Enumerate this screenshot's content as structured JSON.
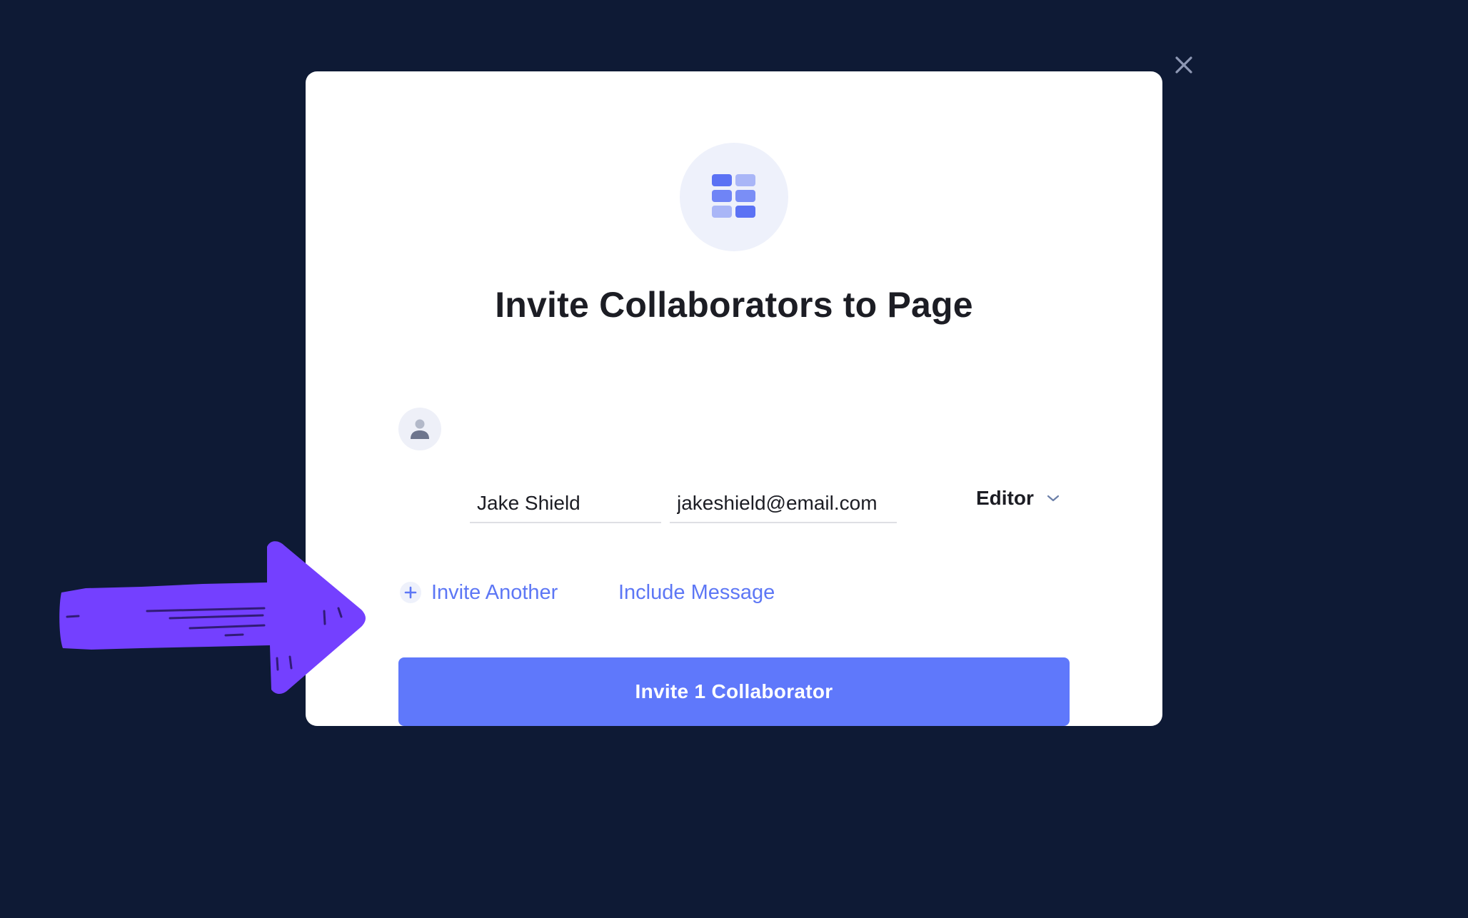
{
  "modal": {
    "title": "Invite Collaborators to Page",
    "close_icon": "close-icon",
    "logo_icon": "grid-logo-icon"
  },
  "invitee": {
    "avatar_icon": "user-avatar-icon",
    "name_value": "Jake Shield",
    "email_value": "jakeshield@email.com",
    "role_selected": "Editor",
    "role_icon": "chevron-down-icon"
  },
  "actions": {
    "invite_another_label": "Invite Another",
    "invite_another_icon": "plus-icon",
    "include_message_label": "Include Message",
    "submit_label": "Invite 1 Collaborator"
  },
  "annotation": {
    "arrow_icon": "hand-drawn-arrow-icon"
  },
  "colors": {
    "backdrop": "#0e1a35",
    "accent": "#5f78fb",
    "link": "#5d77f5",
    "arrow": "#7440ff",
    "title": "#1c1d24"
  }
}
